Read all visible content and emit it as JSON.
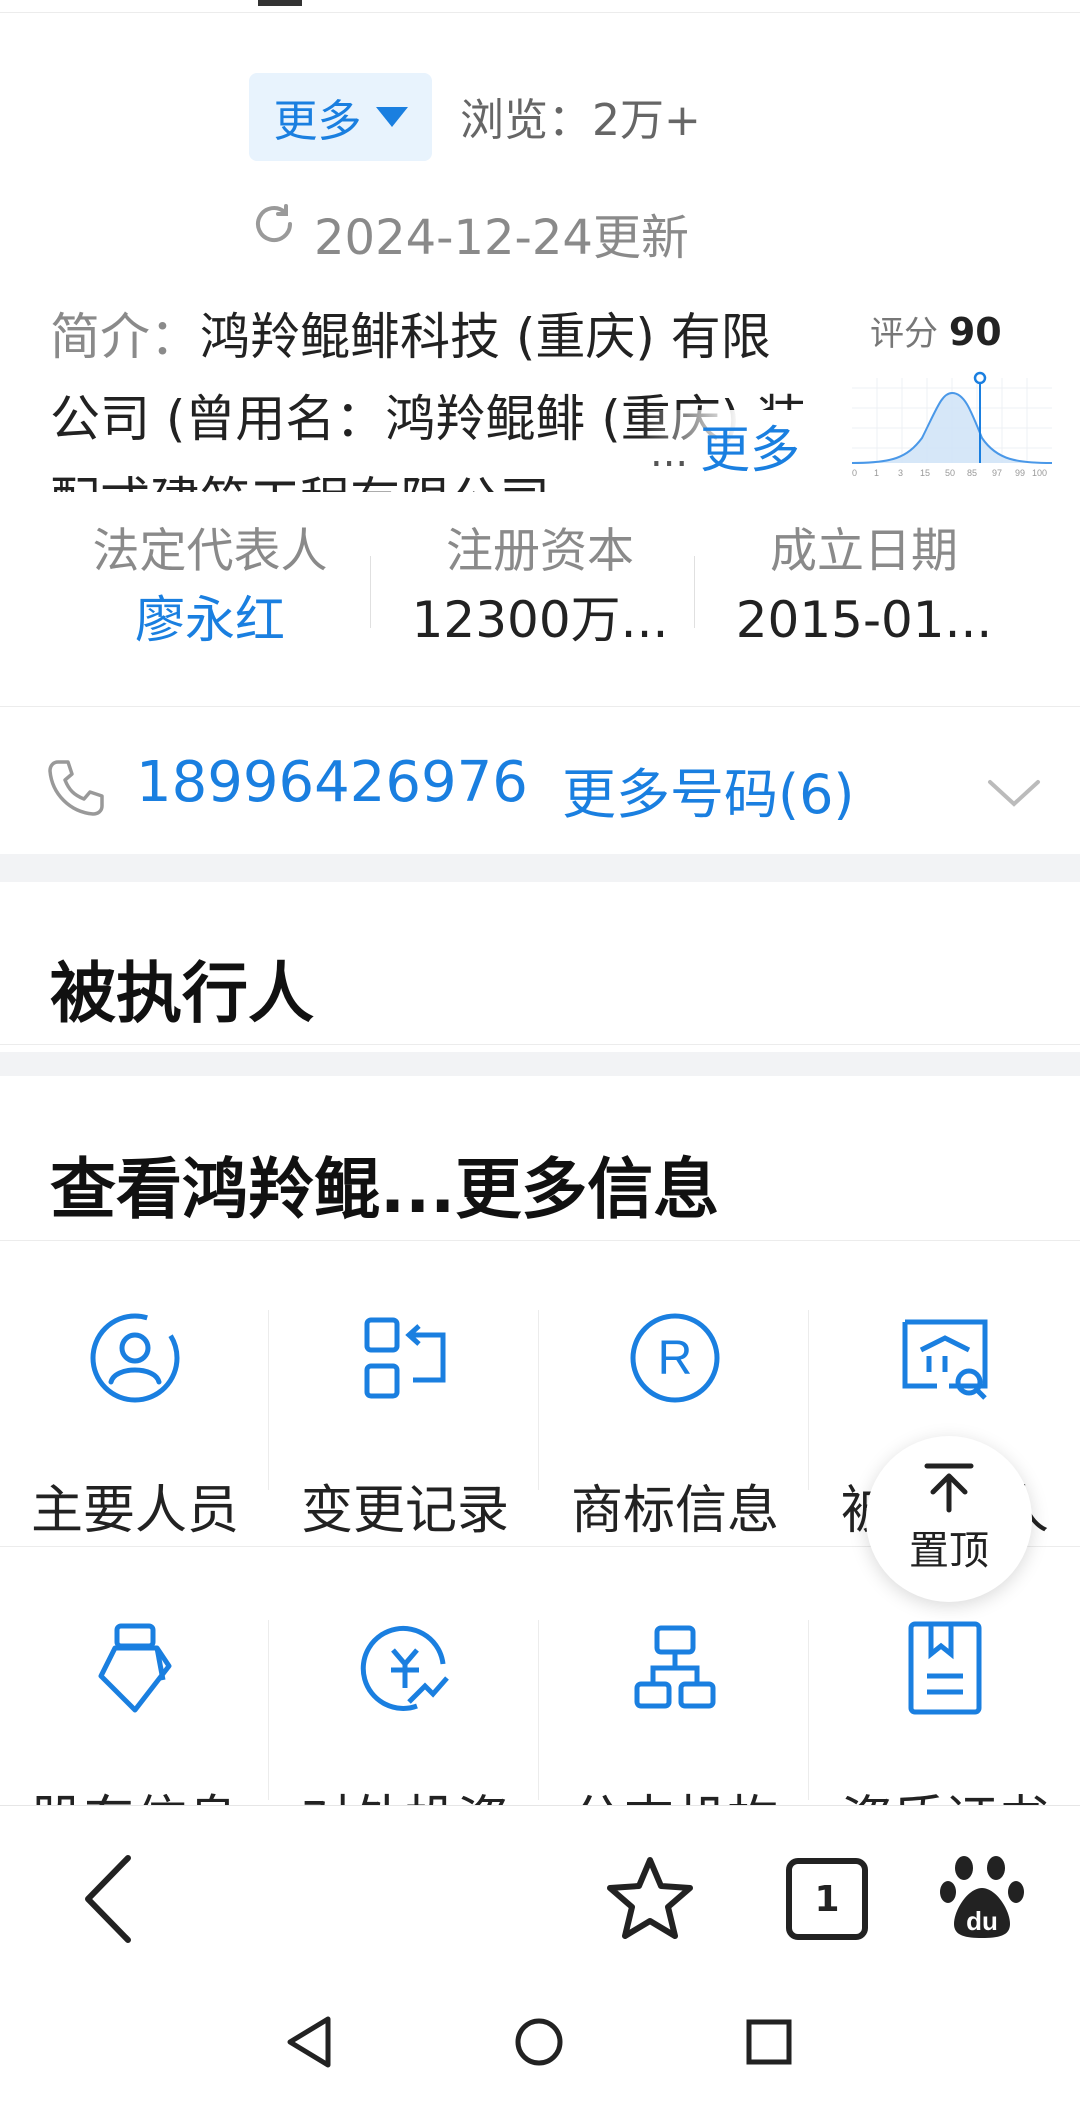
{
  "header": {
    "more_label": "更多",
    "views_label": "浏览：",
    "views_value": "2万+",
    "updated": "2024-12-24更新"
  },
  "intro": {
    "label": "简介：",
    "text": "鸿羚鲲鲱科技 (重庆) 有限公司 (曾用名：鸿羚鲲鲱 (重庆) 装配式建筑工程有限公司",
    "ellipsis": "...",
    "more": "更多"
  },
  "score": {
    "label": "评分",
    "value": "90",
    "axis_ticks": [
      "0",
      "1",
      "3",
      "15",
      "50",
      "85",
      "97",
      "99",
      "100"
    ]
  },
  "info": [
    {
      "title": "法定代表人",
      "value": "廖永红"
    },
    {
      "title": "注册资本",
      "value": "12300万..."
    },
    {
      "title": "成立日期",
      "value": "2015-01..."
    }
  ],
  "phone": {
    "number": "18996426976",
    "more": "更多号码(6)"
  },
  "sections": {
    "executed": "被执行人",
    "more_info": "查看鸿羚鲲...更多信息"
  },
  "grid_row1": [
    {
      "label": "主要人员",
      "icon": "person-icon"
    },
    {
      "label": "变更记录",
      "icon": "change-record-icon"
    },
    {
      "label": "商标信息",
      "icon": "trademark-icon"
    },
    {
      "label": "被执行人",
      "icon": "court-search-icon"
    }
  ],
  "grid_row2": [
    {
      "label": "股东信息",
      "icon": "shareholder-icon"
    },
    {
      "label": "对外投资",
      "icon": "investment-icon"
    },
    {
      "label": "分支机构",
      "icon": "branch-icon"
    },
    {
      "label": "资质证书",
      "icon": "certificate-icon"
    }
  ],
  "to_top": "置顶",
  "bottom_bar": {
    "tabs_count": "1"
  },
  "colors": {
    "accent": "#1a7fe0"
  }
}
